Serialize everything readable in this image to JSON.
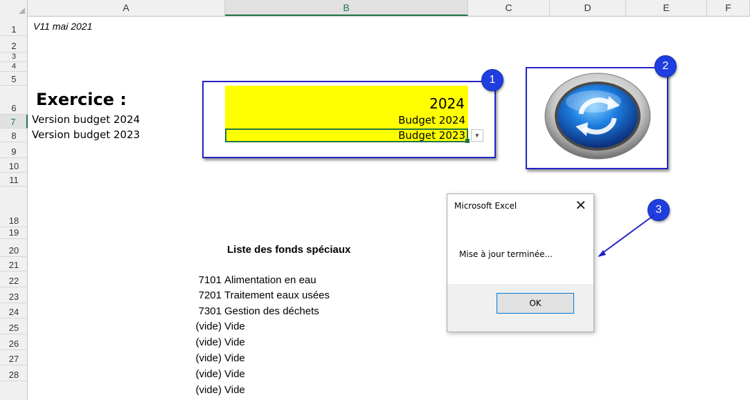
{
  "columns": [
    {
      "label": "A",
      "selected": false
    },
    {
      "label": "B",
      "selected": true
    },
    {
      "label": "C",
      "selected": false
    },
    {
      "label": "D",
      "selected": false
    },
    {
      "label": "E",
      "selected": false
    },
    {
      "label": "F",
      "selected": false
    }
  ],
  "rows": [
    "1",
    "2",
    "3",
    "4",
    "5",
    "6",
    "7",
    "8",
    "9",
    "10",
    "11",
    "18",
    "19",
    "20",
    "21",
    "22",
    "23",
    "24",
    "25",
    "26",
    "27",
    "28"
  ],
  "selected_row": "7",
  "cells": {
    "a1": "V11 mai 2021",
    "a5": "Exercice :",
    "a6": "Version budget 2024",
    "a7": "Version budget 2023",
    "b5": "2024",
    "b6": "Budget 2024",
    "b7": "Budget 2023"
  },
  "list": {
    "title": "Liste des fonds spéciaux",
    "items": [
      {
        "code": "7101",
        "label": "Alimentation en eau"
      },
      {
        "code": "7201",
        "label": "Traitement eaux usées"
      },
      {
        "code": "7301",
        "label": "Gestion des déchets"
      },
      {
        "code": "(vide)",
        "label": "Vide"
      },
      {
        "code": "(vide)",
        "label": "Vide"
      },
      {
        "code": "(vide)",
        "label": "Vide"
      },
      {
        "code": "(vide)",
        "label": "Vide"
      },
      {
        "code": "(vide)",
        "label": "Vide"
      }
    ]
  },
  "badges": {
    "one": "1",
    "two": "2",
    "three": "3"
  },
  "dialog": {
    "title": "Microsoft Excel",
    "message": "Mise à jour terminée...",
    "ok_label": "OK",
    "close_glyph": "✕"
  },
  "icons": {
    "refresh": "refresh-icon",
    "dropdown": "chevron-down-icon",
    "close": "close-icon"
  },
  "colors": {
    "accent": "#217346",
    "highlight": "#ffff00",
    "annotation": "#2222c8",
    "badge": "#1f3ee0"
  }
}
